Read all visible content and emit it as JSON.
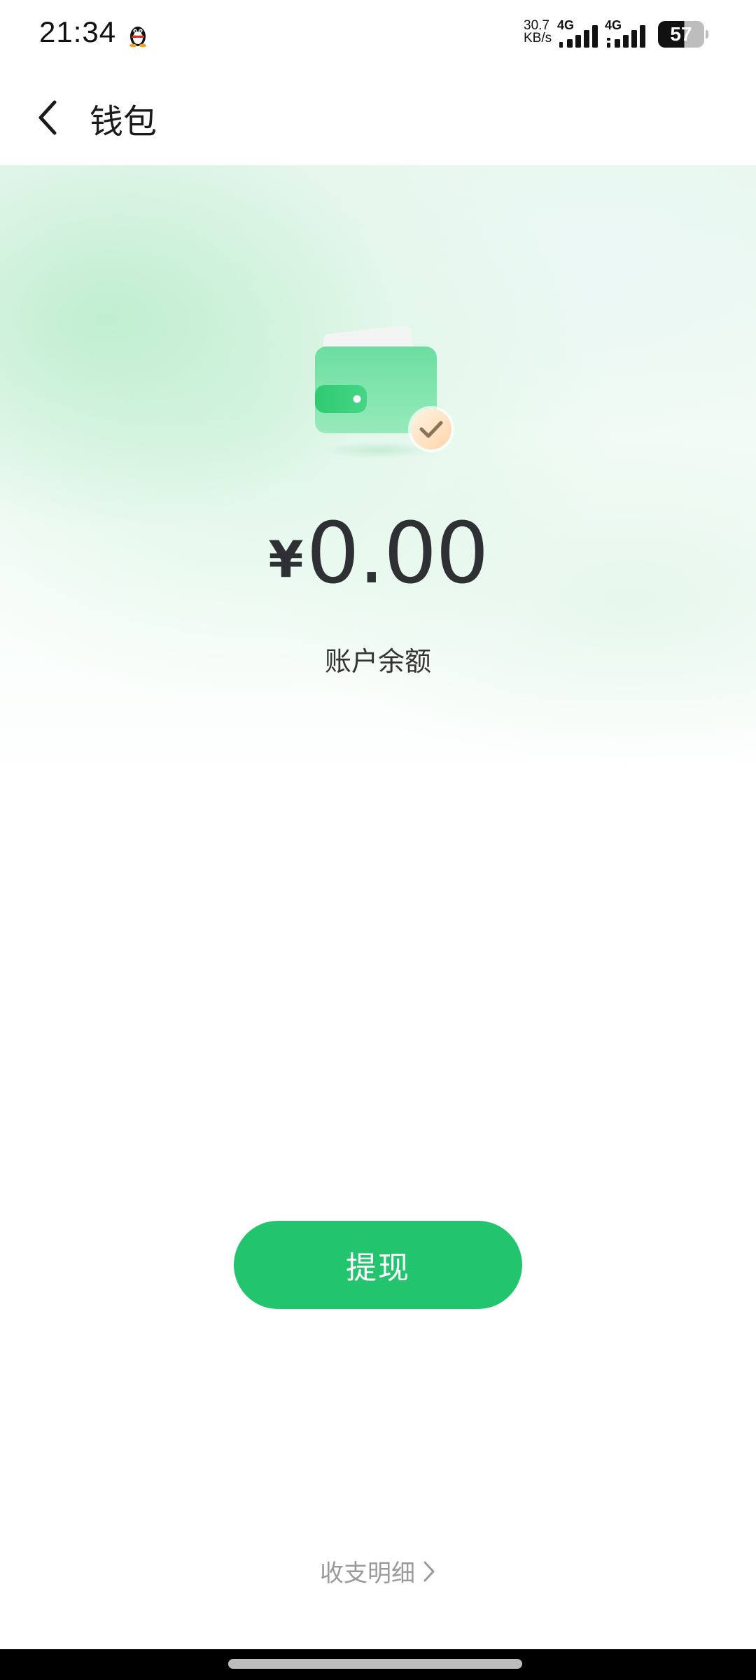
{
  "status_bar": {
    "time": "21:34",
    "net_speed_value": "30.7",
    "net_speed_unit": "KB/s",
    "network_1": "4G",
    "network_2": "4G",
    "battery_level": "57",
    "battery_fraction": 0.57,
    "notification_icon": "qq-penguin-icon"
  },
  "header": {
    "back_icon": "chevron-left-icon",
    "title": "钱包"
  },
  "wallet": {
    "illustration_icon": "wallet-check-icon",
    "currency_symbol": "¥",
    "balance": "0.00",
    "balance_label": "账户余额"
  },
  "actions": {
    "withdraw_label": "提现"
  },
  "footer": {
    "details_label": "收支明细",
    "details_icon": "chevron-right-icon"
  },
  "colors": {
    "accent_green": "#22c56e",
    "text_dark": "#2f3033",
    "text_muted": "#9a9a9a"
  }
}
